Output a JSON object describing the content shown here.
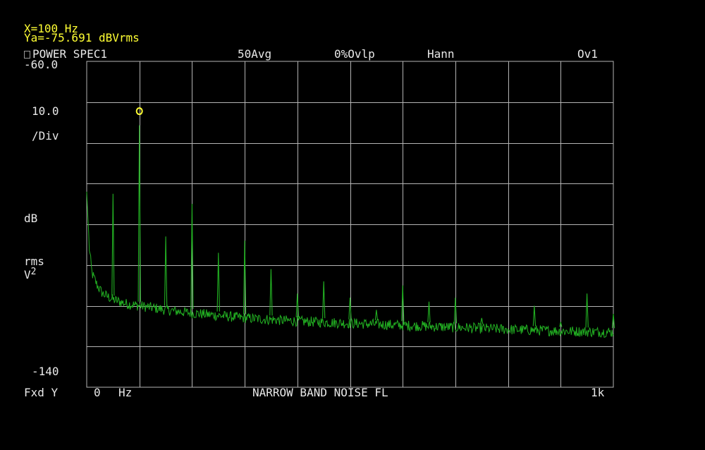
{
  "marker": {
    "x_readout": "X=100 Hz",
    "y_readout": "Ya=-75.691 dBVrms"
  },
  "header": {
    "trace_name": "POWER SPEC1",
    "averaging": "50Avg",
    "overlap": "0%Ovlp",
    "window": "Hann",
    "overload": "Ov1"
  },
  "y_axis": {
    "top_label": "-60.0",
    "scale_value": "10.0",
    "scale_unit": "/Div",
    "unit_line1": "dB",
    "unit_line2": "rms",
    "unit_line3": "V",
    "unit_sup": "2",
    "bottom_label": "-140",
    "scale_mode": "Fxd Y"
  },
  "x_axis": {
    "start_label": "0",
    "start_unit": "Hz",
    "stop_label": "1k"
  },
  "footer": {
    "caption": "NARROW BAND NOISE FL"
  },
  "colors": {
    "background": "#000000",
    "grid": "#b4b4b4",
    "trace": "#22b022",
    "marker": "#ffff33",
    "text": "#e8e8e8"
  },
  "chart_data": {
    "type": "line",
    "xlim": [
      0,
      1000
    ],
    "ylim": [
      -140,
      -60
    ],
    "x_divisions": 10,
    "y_divisions": 8,
    "grid": true,
    "noise_floor": [
      [
        0,
        -92
      ],
      [
        5,
        -106
      ],
      [
        10,
        -112
      ],
      [
        20,
        -115
      ],
      [
        30,
        -117
      ],
      [
        50,
        -118.5
      ],
      [
        75,
        -119.5
      ],
      [
        100,
        -120
      ],
      [
        150,
        -121
      ],
      [
        200,
        -121.8
      ],
      [
        300,
        -123
      ],
      [
        400,
        -123.8
      ],
      [
        500,
        -124.3
      ],
      [
        600,
        -124.8
      ],
      [
        700,
        -125.3
      ],
      [
        800,
        -125.8
      ],
      [
        900,
        -126.2
      ],
      [
        1000,
        -126.5
      ]
    ],
    "peaks": [
      {
        "x": 50,
        "y": -92.5
      },
      {
        "x": 100,
        "y": -75.691
      },
      {
        "x": 150,
        "y": -103
      },
      {
        "x": 200,
        "y": -95
      },
      {
        "x": 250,
        "y": -107
      },
      {
        "x": 300,
        "y": -104
      },
      {
        "x": 350,
        "y": -111
      },
      {
        "x": 400,
        "y": -117
      },
      {
        "x": 450,
        "y": -114
      },
      {
        "x": 500,
        "y": -118
      },
      {
        "x": 550,
        "y": -121
      },
      {
        "x": 600,
        "y": -115
      },
      {
        "x": 650,
        "y": -119
      },
      {
        "x": 700,
        "y": -118
      },
      {
        "x": 750,
        "y": -123
      },
      {
        "x": 850,
        "y": -120
      },
      {
        "x": 900,
        "y": -124
      },
      {
        "x": 950,
        "y": -117
      },
      {
        "x": 1000,
        "y": -122
      }
    ],
    "marker_point": {
      "x": 100,
      "y": -75.691
    }
  }
}
